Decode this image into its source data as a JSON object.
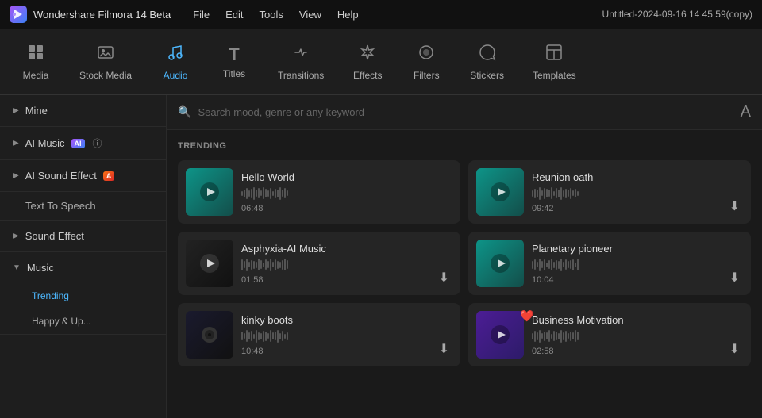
{
  "titleBar": {
    "appName": "Wondershare Filmora 14 Beta",
    "logoChar": "W",
    "menuItems": [
      "File",
      "Edit",
      "Tools",
      "View",
      "Help"
    ],
    "projectName": "Untitled-2024-09-16 14 45 59(copy)"
  },
  "topNav": {
    "items": [
      {
        "id": "media",
        "label": "Media",
        "icon": "⊞",
        "active": false
      },
      {
        "id": "stock-media",
        "label": "Stock Media",
        "icon": "🖼",
        "active": false
      },
      {
        "id": "audio",
        "label": "Audio",
        "icon": "♪",
        "active": true
      },
      {
        "id": "titles",
        "label": "Titles",
        "icon": "T",
        "active": false
      },
      {
        "id": "transitions",
        "label": "Transitions",
        "icon": "↔",
        "active": false
      },
      {
        "id": "effects",
        "label": "Effects",
        "icon": "✦",
        "active": false
      },
      {
        "id": "filters",
        "label": "Filters",
        "icon": "◉",
        "active": false
      },
      {
        "id": "stickers",
        "label": "Stickers",
        "icon": "❋",
        "active": false
      },
      {
        "id": "templates",
        "label": "Templates",
        "icon": "▦",
        "active": false
      }
    ]
  },
  "sidebar": {
    "groups": [
      {
        "id": "mine",
        "label": "Mine",
        "collapsed": true,
        "arrow": "▶",
        "children": []
      },
      {
        "id": "ai-music",
        "label": "AI Music",
        "collapsed": true,
        "arrow": "▶",
        "badge": "AI",
        "showHelp": true,
        "children": []
      },
      {
        "id": "ai-sound-effect",
        "label": "AI Sound Effect",
        "collapsed": true,
        "arrow": "▶",
        "badge": "A",
        "children": []
      },
      {
        "id": "text-to-speech",
        "label": "Text To Speech",
        "collapsed": false,
        "arrow": "",
        "children": []
      },
      {
        "id": "sound-effect",
        "label": "Sound Effect",
        "collapsed": true,
        "arrow": "▶",
        "children": []
      },
      {
        "id": "music",
        "label": "Music",
        "collapsed": false,
        "arrow": "▼",
        "children": [
          {
            "id": "trending",
            "label": "Trending",
            "active": true
          },
          {
            "id": "happy-up",
            "label": "Happy & Up...",
            "active": false
          }
        ]
      }
    ]
  },
  "search": {
    "placeholder": "Search mood, genre or any keyword"
  },
  "content": {
    "sectionLabel": "TRENDING",
    "tracks": [
      {
        "id": "hello-world",
        "title": "Hello World",
        "duration": "06:48",
        "thumbStyle": "teal",
        "hasDownload": false,
        "hasHeart": false
      },
      {
        "id": "reunion-oath",
        "title": "Reunion oath",
        "duration": "09:42",
        "thumbStyle": "teal",
        "hasDownload": true,
        "hasHeart": false
      },
      {
        "id": "asphyxia-ai-music",
        "title": "Asphyxia-AI Music",
        "duration": "01:58",
        "thumbStyle": "dark",
        "hasDownload": true,
        "hasHeart": false
      },
      {
        "id": "planetary-pioneer",
        "title": "Planetary pioneer",
        "duration": "10:04",
        "thumbStyle": "teal",
        "hasDownload": true,
        "hasHeart": false
      },
      {
        "id": "kinky-boots",
        "title": "kinky boots",
        "duration": "10:48",
        "thumbStyle": "dark",
        "hasDownload": true,
        "hasHeart": false
      },
      {
        "id": "business-motivation",
        "title": "Business Motivation",
        "duration": "02:58",
        "thumbStyle": "pink",
        "hasDownload": true,
        "hasHeart": true
      }
    ]
  },
  "icons": {
    "search": "🔍",
    "download": "⬇",
    "heart": "❤",
    "music-note": "♪"
  }
}
